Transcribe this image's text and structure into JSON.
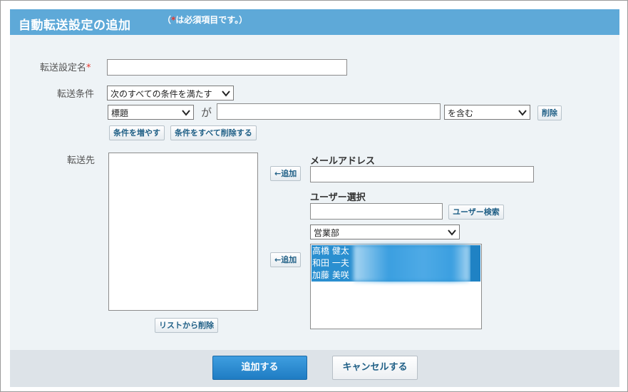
{
  "dialog": {
    "title": "自動転送設定の追加",
    "required_note": {
      "open": "（",
      "star": "*",
      "text": "は必須項目です。）"
    }
  },
  "form": {
    "rule_name": {
      "label": "転送設定名",
      "required_mark": "*",
      "value": ""
    },
    "conditions": {
      "label": "転送条件",
      "match_select": "次のすべての条件を満たす",
      "field_select": "標題",
      "connector": "が",
      "value": "",
      "operator_select": "を含む",
      "delete_button": "削除",
      "add_condition_button": "条件を増やす",
      "delete_all_button": "条件をすべて削除する"
    },
    "destination": {
      "label": "転送先",
      "items": [],
      "remove_button": "リストから削除"
    },
    "email": {
      "label": "メールアドレス",
      "add_button": "←追加",
      "value": ""
    },
    "user_select": {
      "label": "ユーザー選択",
      "search_value": "",
      "search_button": "ユーザー検索",
      "group_select": "営業部",
      "add_button": "←追加",
      "users": [
        "高橋 健太",
        "和田 一夫",
        "加藤 美咲"
      ]
    }
  },
  "footer": {
    "submit_button": "追加する",
    "cancel_button": "キャンセルする"
  },
  "colors": {
    "header_bg": "#5ea9d8",
    "dialog_bg": "#eef3f6",
    "primary_button": "#2a8cd4",
    "required_star": "#e8372c",
    "selection": "#2a8fd0"
  }
}
